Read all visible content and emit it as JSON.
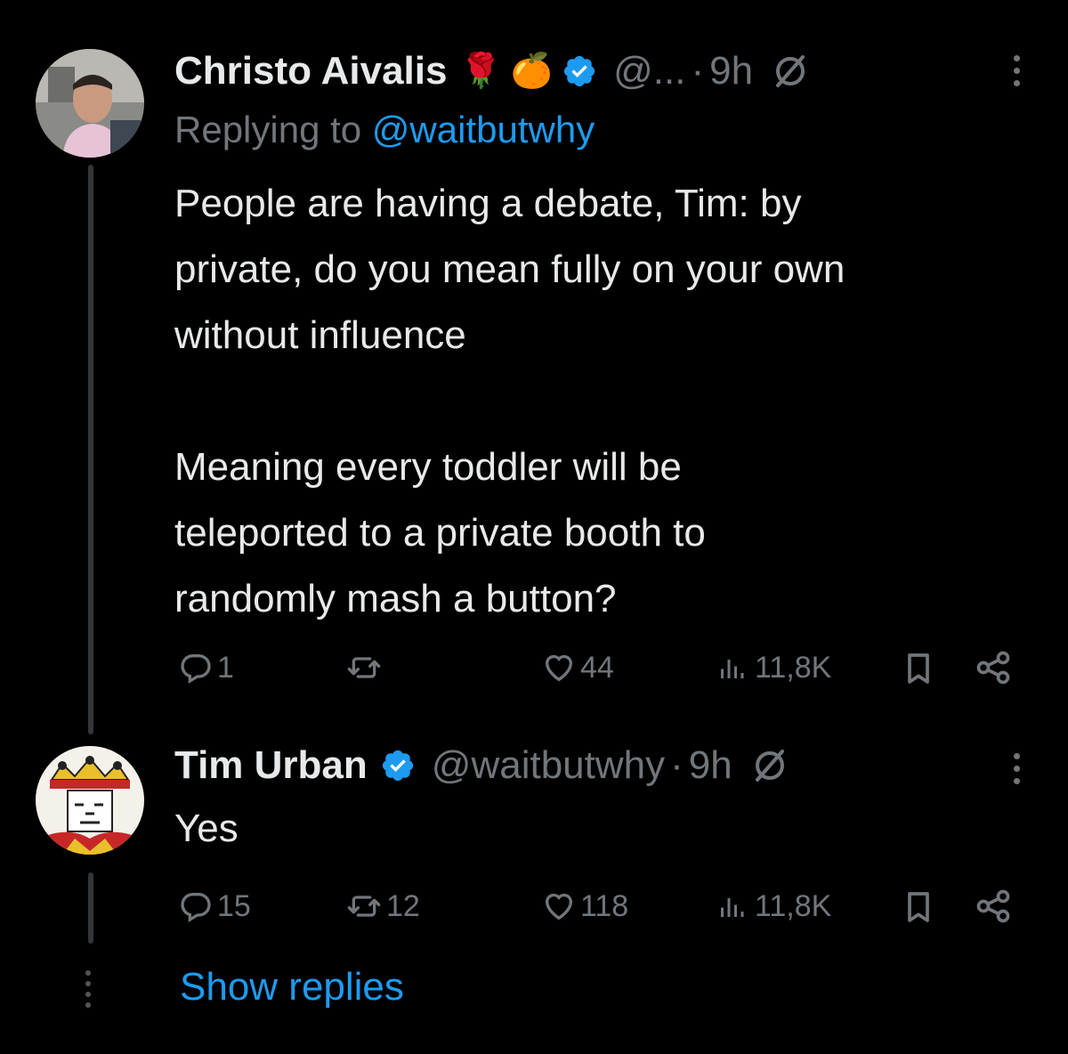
{
  "tweet1": {
    "name": "Christo Aivalis",
    "emoji1": "🌹",
    "emoji2": "🍊",
    "handle": "@...",
    "time": "9h",
    "replying_label": "Replying to",
    "replying_handle": "@waitbutwhy",
    "lines": [
      "People are having a debate, Tim: by",
      "private, do you mean fully on your own",
      "without influence",
      "",
      "Meaning every toddler will be",
      "teleported to a private booth to",
      "randomly mash a button?"
    ],
    "replies": "1",
    "reposts": "",
    "likes": "44",
    "views": "11,8K"
  },
  "tweet2": {
    "name": "Tim Urban",
    "handle": "@waitbutwhy",
    "time": "9h",
    "text": "Yes",
    "replies": "15",
    "reposts": "12",
    "likes": "118",
    "views": "11,8K"
  },
  "show_replies": "Show replies",
  "icons": {
    "verified": "verified-badge-icon",
    "grok": "grok-icon",
    "more": "more-dots-icon",
    "reply": "reply-icon",
    "repost": "repost-icon",
    "like": "heart-icon",
    "views": "views-chart-icon",
    "bookmark": "bookmark-icon",
    "share": "share-icon"
  },
  "colors": {
    "background": "#000000",
    "text": "#e7e9ea",
    "muted": "#71767b",
    "link": "#1d9bf0"
  }
}
